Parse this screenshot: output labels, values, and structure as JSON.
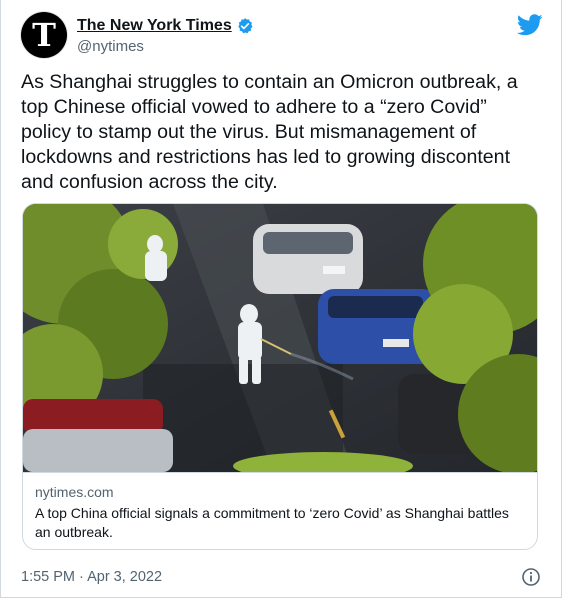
{
  "tweet": {
    "author_name": "The New York Times",
    "handle": "@nytimes",
    "avatar_letter": "T",
    "text": "As Shanghai struggles to contain an Omicron outbreak, a top Chinese official vowed to adhere to a “zero Covid” policy to stamp out the virus. But mismanagement of lockdowns and restrictions has led to growing discontent and confusion across the city.",
    "timestamp": "1:55 PM · Apr 3, 2022"
  },
  "link_card": {
    "domain": "nytimes.com",
    "title": "A top China official signals a commitment to ‘zero Covid’ as Shanghai battles an outbreak."
  },
  "icons": {
    "verified": "verified-badge-icon",
    "brand": "twitter-bird-icon",
    "info": "info-icon"
  },
  "colors": {
    "twitter_blue": "#1d9bf0",
    "secondary_text": "#536471",
    "border": "#cfd9de"
  }
}
